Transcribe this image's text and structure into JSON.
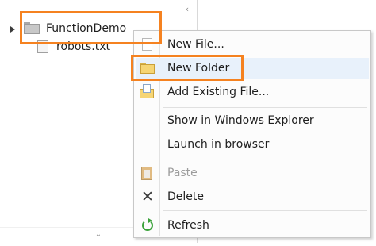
{
  "tree": {
    "project_name": "FunctionDemo",
    "file_name": "robots.txt",
    "expander_icon": "triangle-expanded",
    "scroll_left_glyph": "‹",
    "scroll_down_glyph": "⌄"
  },
  "context_menu": {
    "items": [
      {
        "label": "New File...",
        "icon": "new-file-icon",
        "enabled": true
      },
      {
        "label": "New Folder",
        "icon": "folder-icon",
        "enabled": true,
        "highlighted": true
      },
      {
        "label": "Add Existing File...",
        "icon": "add-existing-file-icon",
        "enabled": true
      },
      {
        "label": "Show in Windows Explorer",
        "icon": "",
        "enabled": true
      },
      {
        "label": "Launch in browser",
        "icon": "",
        "enabled": true
      },
      {
        "label": "Paste",
        "icon": "paste-icon",
        "enabled": false
      },
      {
        "label": "Delete",
        "icon": "delete-icon",
        "enabled": true
      },
      {
        "label": "Refresh",
        "icon": "refresh-icon",
        "enabled": true
      }
    ]
  },
  "colors": {
    "highlight_outline": "#f58220",
    "hover_background": "#e8f1fb",
    "disabled_text": "#9d9d9d"
  }
}
